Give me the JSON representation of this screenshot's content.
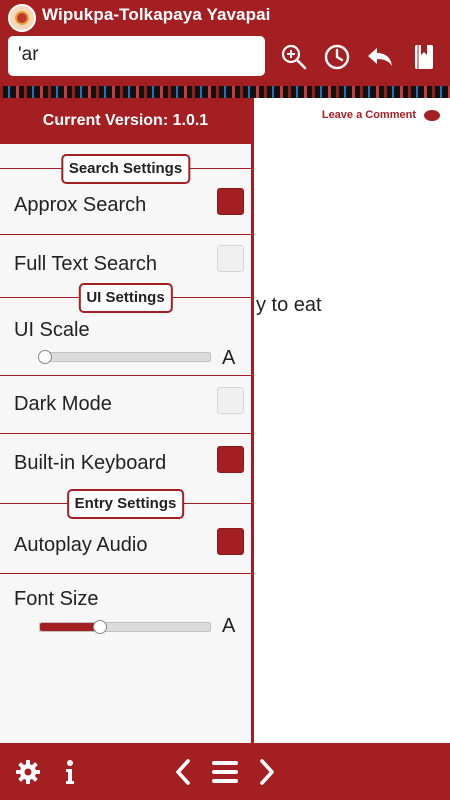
{
  "header": {
    "title": "Wipukpa-Tolkapaya Yavapai",
    "search_value": "'ar",
    "icons": [
      "zoom-in-icon",
      "history-icon",
      "back-icon",
      "bookmarks-icon"
    ]
  },
  "colors": {
    "brand": "#a41f22",
    "background": "#ffffff",
    "drawer_bg": "#f7f7f7"
  },
  "content": {
    "leave_comment": "Leave a Comment",
    "definition_fragment": "y to eat"
  },
  "drawer": {
    "version_label": "Current Version: 1.0.1",
    "search_settings": {
      "header": "Search Settings",
      "approx_search": {
        "label": "Approx Search",
        "checked": true
      },
      "full_text_search": {
        "label": "Full Text Search",
        "checked": false
      }
    },
    "ui_settings": {
      "header": "UI Settings",
      "ui_scale": {
        "label": "UI Scale",
        "value": 0.03,
        "end_label": "A"
      },
      "dark_mode": {
        "label": "Dark Mode",
        "checked": false
      },
      "builtin_keyboard": {
        "label": "Built-in Keyboard",
        "checked": true
      }
    },
    "entry_settings": {
      "header": "Entry Settings",
      "autoplay_audio": {
        "label": "Autoplay Audio",
        "checked": true
      },
      "font_size": {
        "label": "Font Size",
        "value": 0.35,
        "end_label": "A"
      }
    }
  },
  "footer": {
    "icons": [
      "settings-gear-icon",
      "info-icon",
      "previous-chevron-icon",
      "menu-icon",
      "next-chevron-icon"
    ]
  }
}
